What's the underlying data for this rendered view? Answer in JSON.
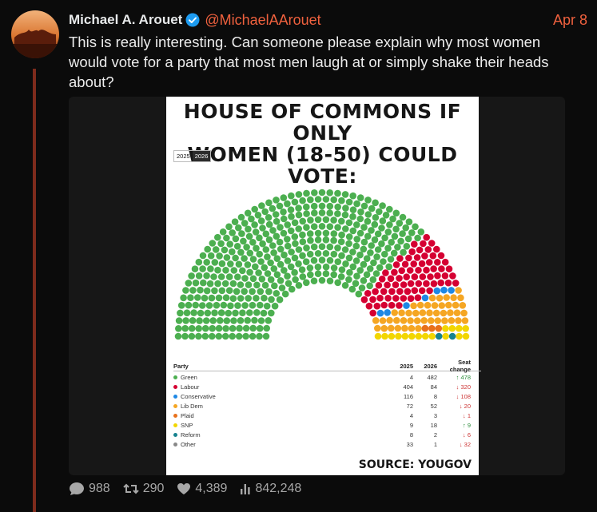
{
  "tweet": {
    "author_name": "Michael A. Arouet",
    "handle": "@MichaelAArouet",
    "date": "Apr 8",
    "text": "This is really interesting. Can someone please explain why most women would vote for a party that most men laugh at or simply shake their heads about?"
  },
  "infographic": {
    "title_line1": "HOUSE OF COMMONS IF ONLY",
    "title_line2": "WOMEN (18-50) COULD VOTE:",
    "year_tabs": [
      "2025",
      "2026"
    ],
    "active_year": "2026",
    "source": "SOURCE: YOUGOV",
    "table_headers": {
      "party": "Party",
      "y2025": "2025",
      "y2026": "2026",
      "change": "Seat change"
    },
    "parties": [
      {
        "name": "Green",
        "y2025": "4",
        "y2026": "482",
        "change": "↑ 478",
        "dir": "up",
        "color": "#4caf50"
      },
      {
        "name": "Labour",
        "y2025": "404",
        "y2026": "84",
        "change": "↓ 320",
        "dir": "down",
        "color": "#d50032"
      },
      {
        "name": "Conservative",
        "y2025": "116",
        "y2026": "8",
        "change": "↓ 108",
        "dir": "down",
        "color": "#1e88e5"
      },
      {
        "name": "Lib Dem",
        "y2025": "72",
        "y2026": "52",
        "change": "↓ 20",
        "dir": "down",
        "color": "#f5a623"
      },
      {
        "name": "Plaid",
        "y2025": "4",
        "y2026": "3",
        "change": "↓ 1",
        "dir": "down",
        "color": "#e8711c"
      },
      {
        "name": "SNP",
        "y2025": "9",
        "y2026": "18",
        "change": "↑ 9",
        "dir": "up",
        "color": "#f2d600"
      },
      {
        "name": "Reform",
        "y2025": "8",
        "y2026": "2",
        "change": "↓ 6",
        "dir": "down",
        "color": "#17838f"
      },
      {
        "name": "Other",
        "y2025": "33",
        "y2026": "1",
        "change": "↓ 32",
        "dir": "down",
        "color": "#888888"
      }
    ]
  },
  "stats": {
    "replies": "988",
    "retweets": "290",
    "likes": "4,389",
    "views": "842,248"
  },
  "colors": {
    "accent": "#f0613e",
    "thread_line": "#7e2b1c",
    "verified": "#1d9bf0"
  }
}
